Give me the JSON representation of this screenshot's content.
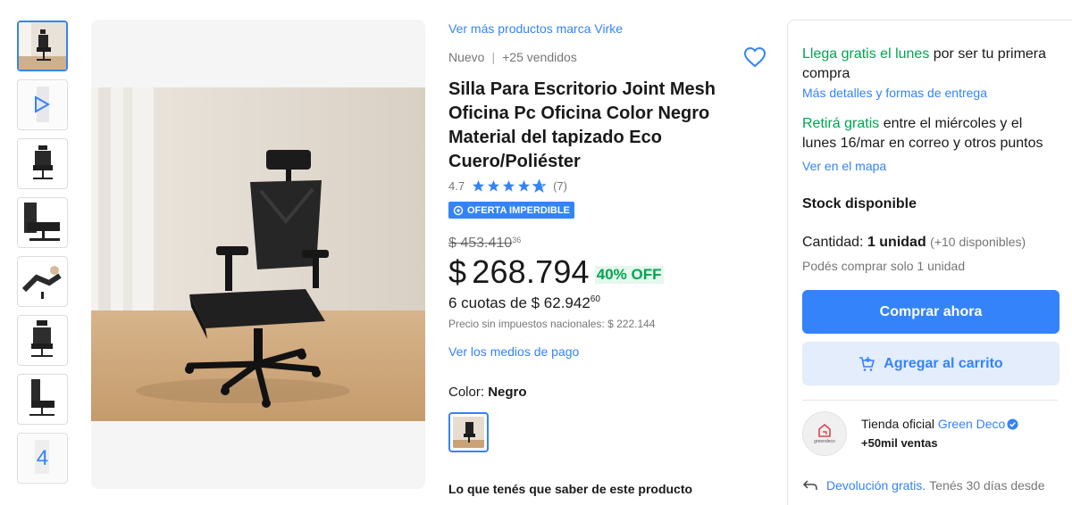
{
  "thumbnails": [
    {
      "name": "chair-room-photo",
      "active": true
    },
    {
      "name": "video",
      "active": false
    },
    {
      "name": "chair-front",
      "active": false
    },
    {
      "name": "chair-side",
      "active": false
    },
    {
      "name": "person-reclining",
      "active": false
    },
    {
      "name": "chair-back",
      "active": false
    },
    {
      "name": "chair-side-2",
      "active": false
    },
    {
      "name": "more-images",
      "active": false,
      "more_count": "4"
    }
  ],
  "product": {
    "brand_link": "Ver más productos marca Virke",
    "condition": "Nuevo",
    "sold": "+25 vendidos",
    "title": "Silla Para Escritorio Joint Mesh Oficina Pc Oficina Color Negro Material del tapizado Eco Cuero/Poliéster",
    "rating_value": "4.7",
    "rating_count": "(7)",
    "rating_fraction": 0.94,
    "badge": "OFERTA IMPERDIBLE",
    "original_price": "$ 453.410",
    "original_cents": "36",
    "price_currency": "$",
    "price": "268.794",
    "discount": "40% OFF",
    "installments": "6 cuotas de $ 62.942",
    "installments_cents": "60",
    "taxes": "Precio sin impuestos nacionales: $ 222.144",
    "payment_link": "Ver los medios de pago",
    "color_label": "Color: ",
    "color_value": "Negro",
    "know_title": "Lo que tenés que saber de este producto"
  },
  "panel": {
    "ship1_green": "Llega gratis el lunes",
    "ship1_rest": " por ser tu primera compra",
    "ship1_link": "Más detalles y formas de entrega",
    "ship2_green": "Retirá gratis",
    "ship2_rest": " entre el miércoles y el lunes 16/mar en correo y otros puntos",
    "ship2_link": "Ver en el mapa",
    "stock": "Stock disponible",
    "qty_label": "Cantidad: ",
    "qty_value": "1 unidad",
    "qty_avail": "(+10 disponibles)",
    "limit": "Podés comprar solo 1 unidad",
    "buy_button": "Comprar ahora",
    "cart_button": "Agregar al carrito",
    "store_prefix": "Tienda oficial ",
    "store_name": "Green Deco",
    "store_logo_text": "greendeco",
    "sales": "+50mil ventas",
    "returns_link": "Devolución gratis.",
    "returns_text": "Tenés 30 días desde"
  },
  "colors": {
    "accent": "#3483fa",
    "green": "#00a650",
    "cart_bg": "#e3edfb"
  }
}
